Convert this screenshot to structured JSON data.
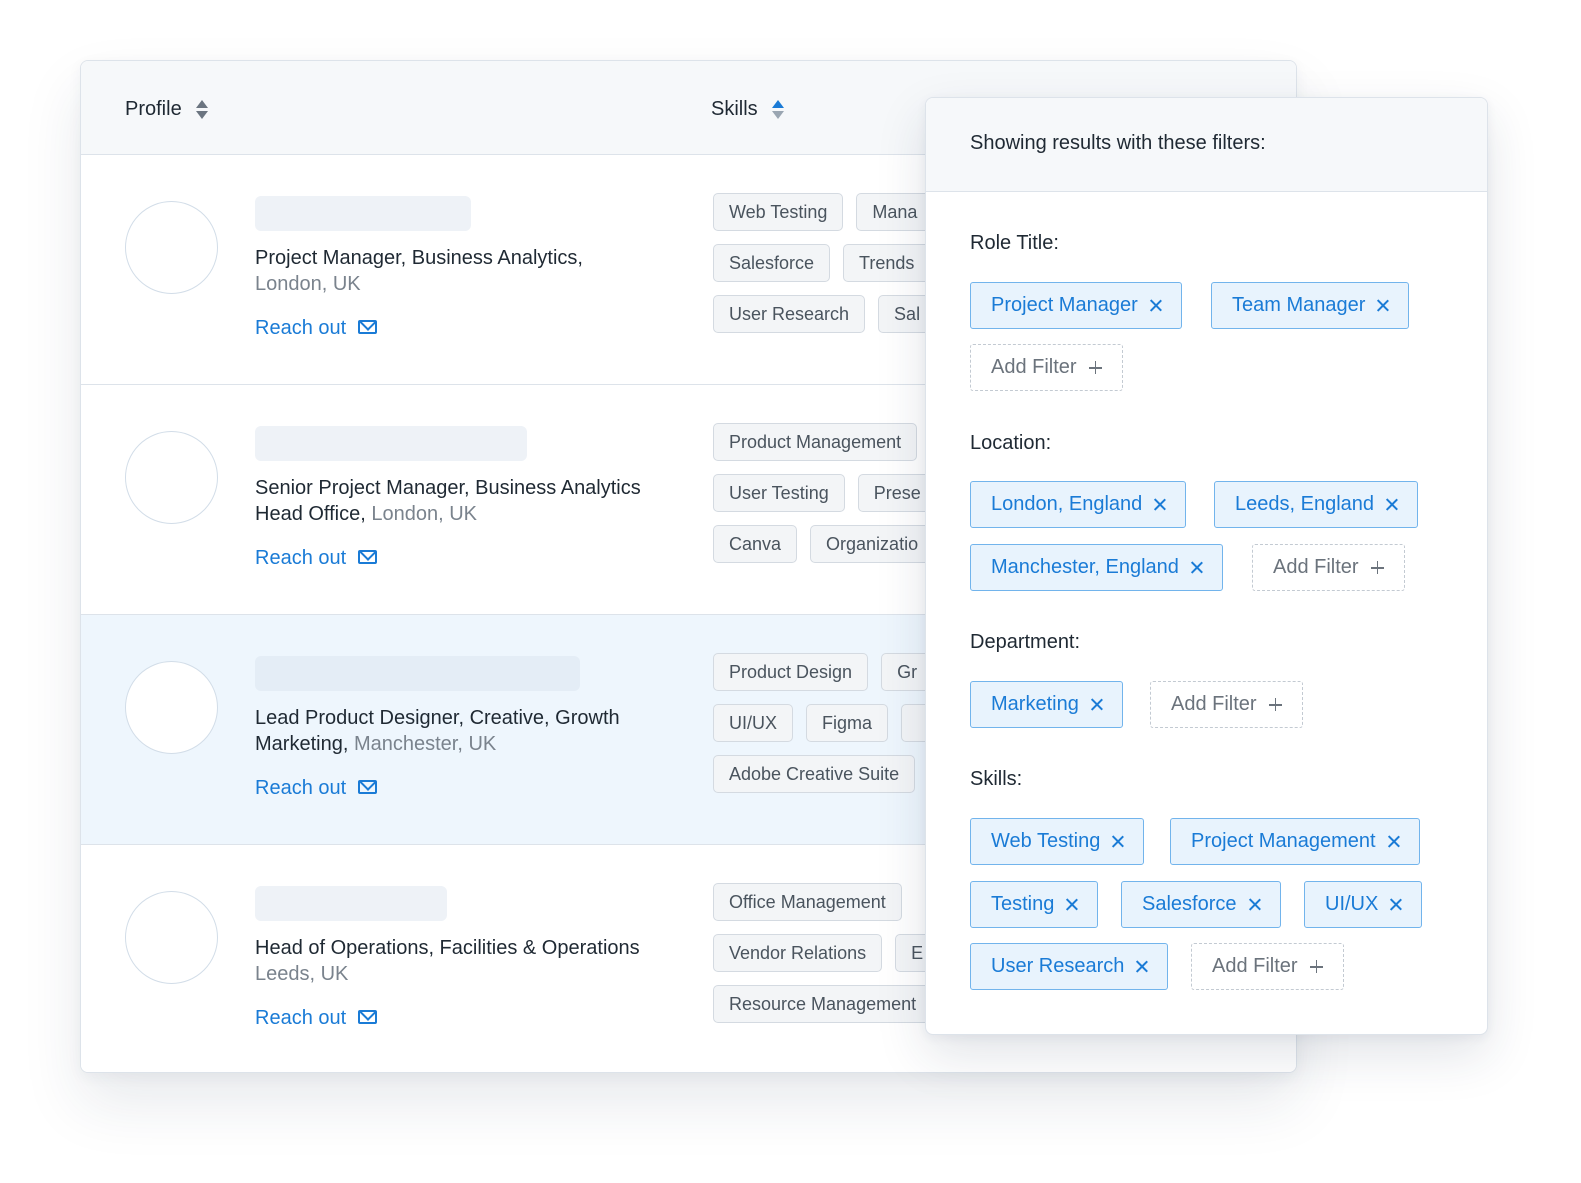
{
  "table": {
    "columns": {
      "profile": "Profile",
      "skills": "Skills"
    },
    "reach_out_label": "Reach out",
    "rows": [
      {
        "role": "Project Manager, Business Analytics,",
        "location": "London, UK",
        "skills": [
          [
            "Web Testing",
            "Mana"
          ],
          [
            "Salesforce",
            "Trends"
          ],
          [
            "User Research",
            "Sal"
          ]
        ]
      },
      {
        "role": "Senior Project Manager, Business Analytics Head Office,",
        "location": "London, UK",
        "skills": [
          [
            "Product Management"
          ],
          [
            "User Testing",
            "Prese"
          ],
          [
            "Canva",
            "Organizatio"
          ]
        ]
      },
      {
        "role": "Lead Product Designer, Creative, Growth Marketing,",
        "location": "Manchester, UK",
        "skills": [
          [
            "Product Design",
            "Gr"
          ],
          [
            "UI/UX",
            "Figma",
            ""
          ],
          [
            "Adobe Creative Suite"
          ]
        ]
      },
      {
        "role": "Head of Operations, Facilities & Operations",
        "location": "Leeds, UK",
        "skills": [
          [
            "Office Management"
          ],
          [
            "Vendor Relations",
            "E"
          ],
          [
            "Resource Management"
          ]
        ]
      }
    ]
  },
  "filters": {
    "title": "Showing results with these filters:",
    "add_label": "Add Filter",
    "groups": {
      "role": {
        "label": "Role Title:",
        "items": [
          "Project Manager",
          "Team Manager"
        ]
      },
      "location": {
        "label": "Location:",
        "items": [
          "London, England",
          "Leeds, England",
          "Manchester, England"
        ]
      },
      "department": {
        "label": "Department:",
        "items": [
          "Marketing"
        ]
      },
      "skills": {
        "label": "Skills:",
        "items": [
          "Web Testing",
          "Project Management",
          "Testing",
          "Salesforce",
          "UI/UX",
          "User Research"
        ]
      }
    }
  },
  "colors": {
    "accent": "#1a7bd6",
    "highlight_row": "#eef6fd",
    "chip_fill": "#e8f3fd"
  }
}
